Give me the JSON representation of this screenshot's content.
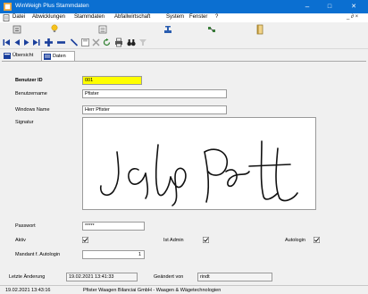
{
  "window": {
    "title": "WinWeigh Plus Stammdaten",
    "minimize": "–",
    "maximize": "□",
    "close": "✕"
  },
  "menu": {
    "items": [
      "Datei",
      "Abwicklungen",
      "Stammdaten",
      "Abfallwirtschaft",
      "System",
      "Fenster",
      "?"
    ],
    "mdi_controls": "_ ∂ ×"
  },
  "tabs": [
    {
      "label": "Übersicht"
    },
    {
      "label": "Daten"
    }
  ],
  "form": {
    "user_id": {
      "label": "Benutzer ID",
      "value": "001"
    },
    "username": {
      "label": "Benutzername",
      "value": "Pfister"
    },
    "windows_name": {
      "label": "Windows Name",
      "value": "Herr Pfister"
    },
    "signature": {
      "label": "Signatur"
    },
    "password": {
      "label": "Passwort",
      "value": "*****"
    },
    "active": {
      "label": "Aktiv",
      "checked": true
    },
    "is_admin": {
      "label": "Ist Admin",
      "checked": true
    },
    "autologin": {
      "label": "Autologin",
      "checked": true
    },
    "mandant_autologin": {
      "label": "Mandant f. Autologin",
      "value": "1"
    }
  },
  "footer": {
    "last_change_label": "Letzte Änderung",
    "last_change_value": "19.02.2021 13:41:33",
    "changed_by_label": "Geändert von",
    "changed_by_value": "rindt"
  },
  "statusbar": {
    "date_time": "19.02.2021 13:43:16",
    "company": "Pfister Waagen Bilanciai GmbH - Waagen & Wägetechnologien"
  },
  "colors": {
    "titlebar": "#0b6fd1",
    "highlight_field": "#ffff00",
    "nav_blue": "#1a3f9c"
  }
}
